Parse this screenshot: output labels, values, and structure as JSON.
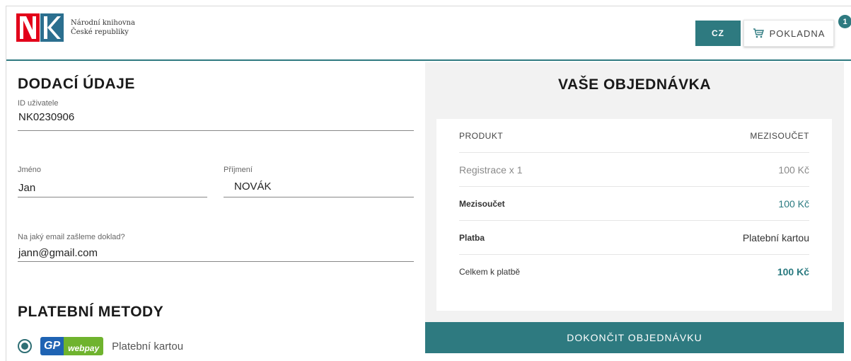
{
  "header": {
    "logo_line1": "Národní knihovna",
    "logo_line2": "České republiky",
    "lang": "CZ",
    "cart_label": "POKLADNA",
    "cart_count": "1"
  },
  "delivery": {
    "title": "DODACÍ ÚDAJE",
    "user_id_label": "ID uživatele",
    "user_id_value": "NK0230906",
    "first_name_label": "Jméno",
    "first_name_value": "Jan",
    "last_name_label": "Příjmení",
    "last_name_value": "NOVÁK",
    "email_label": "Na jaký email zašleme doklad?",
    "email_value": "jann@gmail.com"
  },
  "payment": {
    "title": "PLATEBNÍ METODY",
    "gp_text": "GP",
    "webpay_text": "webpay",
    "method_label": "Platební kartou"
  },
  "order": {
    "title": "VAŠE OBJEDNÁVKA",
    "col_product": "PRODUKT",
    "col_subtotal": "MEZISOUČET",
    "item_name": "Registrace x 1",
    "item_price": "100 Kč",
    "subtotal_label": "Mezisoučet",
    "subtotal_value": "100 Kč",
    "payment_label": "Platba",
    "payment_value": "Platební kartou",
    "total_label": "Celkem k platbě",
    "total_value": "100 Kč",
    "finish_button": "DOKONČIT OBJEDNÁVKU"
  },
  "colors": {
    "accent": "#2e7a80",
    "brand_red": "#e2001a",
    "brand_blue": "#2b6f8f"
  }
}
